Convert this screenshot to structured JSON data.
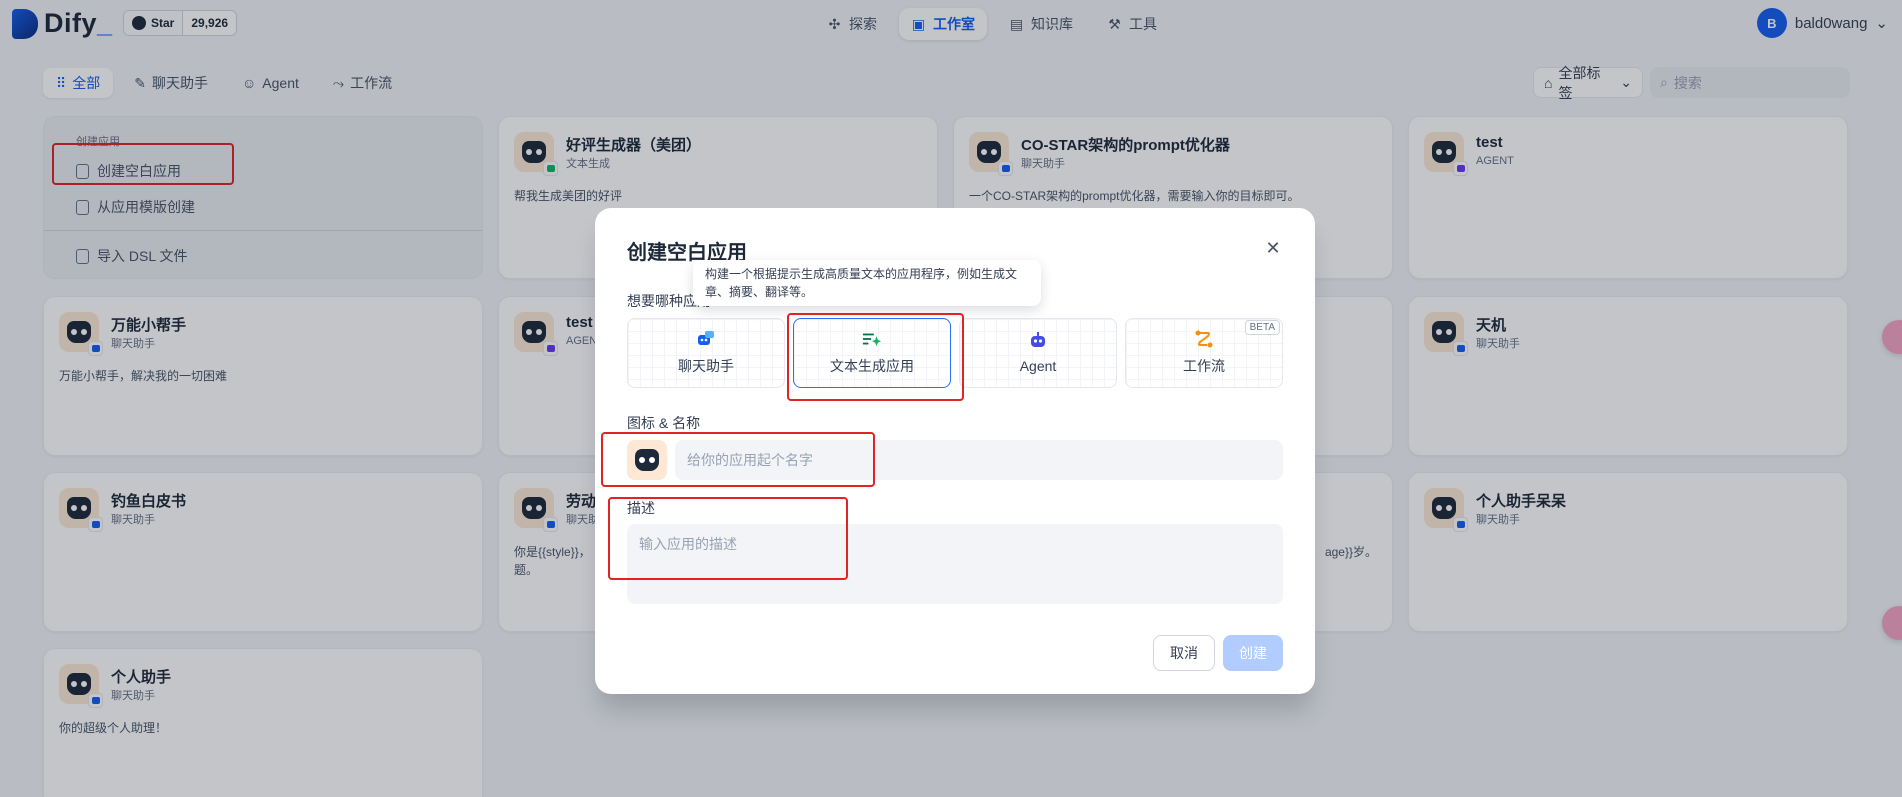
{
  "topbar": {
    "logo_text": "Dify",
    "github_star_label": "Star",
    "github_star_count": "29,926",
    "nav": [
      {
        "label": "探索",
        "icon": "explore-icon"
      },
      {
        "label": "工作室",
        "icon": "studio-icon",
        "active": true
      },
      {
        "label": "知识库",
        "icon": "knowledge-icon"
      },
      {
        "label": "工具",
        "icon": "tools-icon"
      }
    ],
    "user": {
      "avatar_letter": "B",
      "name": "bald0wang"
    }
  },
  "filters": {
    "tabs": [
      {
        "label": "全部",
        "active": true
      },
      {
        "label": "聊天助手"
      },
      {
        "label": "Agent"
      },
      {
        "label": "工作流"
      }
    ],
    "tag_filter_label": "全部标签",
    "search_placeholder": "搜索"
  },
  "create_card": {
    "heading": "创建应用",
    "blank_label": "创建空白应用",
    "template_label": "从应用模版创建",
    "import_label": "导入 DSL 文件"
  },
  "apps": [
    {
      "name": "好评生成器（美团）",
      "type": "文本生成",
      "desc": "帮我生成美团的好评",
      "kind": "text"
    },
    {
      "name": "CO-STAR架构的prompt优化器",
      "type": "聊天助手",
      "desc": "一个CO-STAR架构的prompt优化器，需要输入你的目标即可。",
      "kind": "chat"
    },
    {
      "name": "test",
      "type": "AGENT",
      "desc": "",
      "kind": "agent"
    },
    {
      "name": "万能小帮手",
      "type": "聊天助手",
      "desc": "万能小帮手，解决我的一切困难",
      "kind": "chat"
    },
    {
      "name": "test",
      "type": "AGEN",
      "desc": "",
      "kind": "agent"
    },
    {
      "name": "天机",
      "type": "聊天助手",
      "desc": "",
      "kind": "chat"
    },
    {
      "name": "钓鱼白皮书",
      "type": "聊天助手",
      "desc": "",
      "kind": "chat"
    },
    {
      "name": "劳动",
      "type": "聊天助",
      "desc": "你是{{style}}，\n题。",
      "kind": "chat"
    },
    {
      "name": "",
      "type": "",
      "desc": "age}}岁。",
      "kind": "chat"
    },
    {
      "name": "个人助手呆呆",
      "type": "聊天助手",
      "desc": "",
      "kind": "chat"
    },
    {
      "name": "个人助手",
      "type": "聊天助手",
      "desc": "你的超级个人助理！",
      "kind": "chat"
    }
  ],
  "modal": {
    "title": "创建空白应用",
    "type_question": "想要哪种应用",
    "tooltip": "构建一个根据提示生成高质量文本的应用程序，例如生成文章、摘要、翻译等。",
    "types": [
      {
        "label": "聊天助手",
        "icon": "chat-bot-icon",
        "color": "#155eef"
      },
      {
        "label": "文本生成应用",
        "icon": "text-generation-icon",
        "color": "#087443",
        "selected": true
      },
      {
        "label": "Agent",
        "icon": "agent-robot-icon",
        "color": "#444ce7"
      },
      {
        "label": "工作流",
        "icon": "workflow-icon",
        "color": "#f79009",
        "beta": "BETA"
      }
    ],
    "name_label": "图标 & 名称",
    "name_placeholder": "给你的应用起个名字",
    "desc_label": "描述",
    "desc_placeholder": "输入应用的描述",
    "cancel_label": "取消",
    "create_label": "创建"
  },
  "colors": {
    "accent": "#155eef",
    "annotation": "#e02424"
  }
}
